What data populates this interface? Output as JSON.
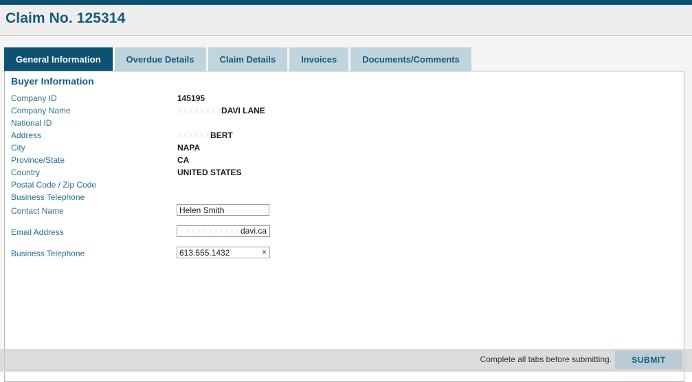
{
  "header": {
    "title": "Claim No. 125314",
    "accent_color": "#0d5272"
  },
  "tabs": [
    {
      "label": "General Information",
      "active": true
    },
    {
      "label": "Overdue Details",
      "active": false
    },
    {
      "label": "Claim Details",
      "active": false
    },
    {
      "label": "Invoices",
      "active": false
    },
    {
      "label": "Documents/Comments",
      "active": false
    }
  ],
  "main": {
    "section_title": "Buyer Information",
    "rows": [
      {
        "label": "Company ID",
        "value": "145195",
        "redacted_prefix": ""
      },
      {
        "label": "Company Name",
        "value": "DAVI LANE",
        "redacted_prefix": "XXXXXXXX"
      },
      {
        "label": "National ID",
        "value": "",
        "redacted_prefix": ""
      },
      {
        "label": "Address",
        "value": "BERT",
        "redacted_prefix": "XXXXXX"
      },
      {
        "label": "City",
        "value": "NAPA",
        "redacted_prefix": ""
      },
      {
        "label": "Province/State",
        "value": "CA",
        "redacted_prefix": ""
      },
      {
        "label": "Country",
        "value": "UNITED STATES",
        "redacted_prefix": ""
      },
      {
        "label": "Postal Code / Zip Code",
        "value": "",
        "redacted_prefix": ""
      },
      {
        "label": "Business Telephone",
        "value": "",
        "redacted_prefix": ""
      }
    ],
    "fields": {
      "contact_name": {
        "label": "Contact Name",
        "value": "Helen Smith",
        "placeholder": ""
      },
      "email_address": {
        "label": "Email Address",
        "value": "davi.ca",
        "redacted_prefix": "XXXXXXXXXX",
        "placeholder": ""
      },
      "business_telephone": {
        "label": "Business Telephone",
        "value": "613.555.1432",
        "placeholder": "",
        "clear_icon": "×"
      }
    }
  },
  "footer": {
    "note": "Complete all tabs before submitting.",
    "submit_label": "SUBMIT",
    "submit_color": "#b9ccd6"
  }
}
